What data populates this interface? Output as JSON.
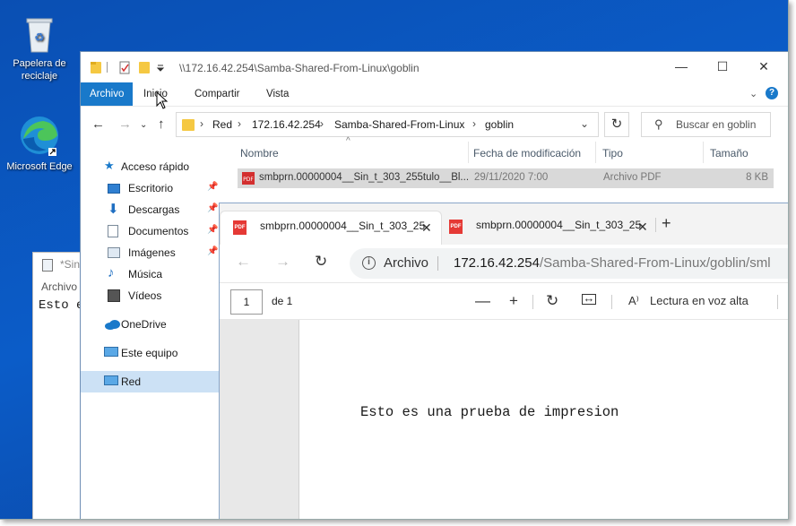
{
  "desktop": {
    "icons": [
      {
        "label": "Papelera de reciclaje",
        "icon": "recycle-bin-icon"
      },
      {
        "label": "Microsoft Edge",
        "icon": "edge-icon"
      }
    ]
  },
  "notepad": {
    "title": "*Sin",
    "menu_label": "Archivo",
    "content": "Esto e"
  },
  "explorer": {
    "title_path": "\\\\172.16.42.254\\Samba-Shared-From-Linux\\goblin",
    "ribbon_tabs": [
      "Archivo",
      "Inicio",
      "Compartir",
      "Vista"
    ],
    "breadcrumbs": [
      "Red",
      "172.16.42.254",
      "Samba-Shared-From-Linux",
      "goblin"
    ],
    "search_placeholder": "Buscar en goblin",
    "nav_items": [
      {
        "label": "Acceso rápido"
      },
      {
        "label": "Escritorio"
      },
      {
        "label": "Descargas"
      },
      {
        "label": "Documentos"
      },
      {
        "label": "Imágenes"
      },
      {
        "label": "Música"
      },
      {
        "label": "Vídeos"
      },
      {
        "label": "OneDrive"
      },
      {
        "label": "Este equipo"
      },
      {
        "label": "Red"
      }
    ],
    "columns": [
      "Nombre",
      "Fecha de modificación",
      "Tipo",
      "Tamaño"
    ],
    "files": [
      {
        "name": "smbprn.00000004__Sin_t_303_255tulo__Bl...",
        "modified": "29/11/2020 7:00",
        "type": "Archivo PDF",
        "size": "8 KB"
      }
    ]
  },
  "edge": {
    "tabs": [
      {
        "title": "smbprn.00000004__Sin_t_303_25"
      },
      {
        "title": "smbprn.00000004__Sin_t_303_25"
      }
    ],
    "address_scheme": "Archivo",
    "address_host": "172.16.42.254",
    "address_path": "/Samba-Shared-From-Linux/goblin/sml",
    "pdf_toolbar": {
      "page": "1",
      "page_total": "de 1",
      "read_aloud": "Lectura en voz alta"
    },
    "pdf_content": "Esto es una prueba de impresion"
  },
  "colors": {
    "desktop_blue": "#0b5cc8",
    "ribbon_active": "#1979ca",
    "selection": "#cce1f5",
    "pdf_red": "#e53935"
  }
}
